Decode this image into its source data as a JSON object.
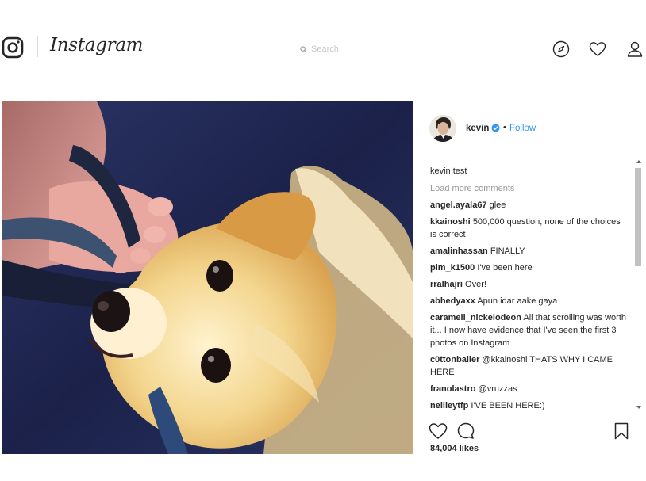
{
  "header": {
    "brand": "Instagram",
    "search_placeholder": "Search",
    "icons": [
      "instagram-camera-icon",
      "compass-icon",
      "heart-icon",
      "user-icon"
    ]
  },
  "post": {
    "author": {
      "username": "kevin",
      "verified": true,
      "separator": "•",
      "follow_label": "Follow"
    },
    "caption": "kevin test",
    "load_more_label": "Load more comments",
    "comments": [
      {
        "user": "angel.ayala67",
        "text": "glee"
      },
      {
        "user": "kkainoshi",
        "text": "500,000 question, none of the choices is correct"
      },
      {
        "user": "amalinhassan",
        "text": "FINALLY"
      },
      {
        "user": "pim_k1500",
        "text": "I've been here"
      },
      {
        "user": "rralhajri",
        "text": "Over!"
      },
      {
        "user": "abhedyaxx",
        "text": "Apun idar aake gaya"
      },
      {
        "user": "caramell_nickelodeon",
        "text": "All that scrolling was worth it... I now have evidence that I've seen the first 3 photos on Instagram"
      },
      {
        "user": "c0ttonballer",
        "text": "@kkainoshi THATS WHY I CAME HERE"
      },
      {
        "user": "franolastro",
        "text": "@vruzzas"
      },
      {
        "user": "nellieytfp",
        "text": "I'VE BEEN HERE:)"
      }
    ],
    "likes": "84,004 likes",
    "action_icons": [
      "heart-icon",
      "comment-icon",
      "bookmark-icon"
    ]
  },
  "colors": {
    "link": "#3897f0",
    "text": "#262626",
    "muted": "#999999",
    "border": "#dbdbdb"
  }
}
